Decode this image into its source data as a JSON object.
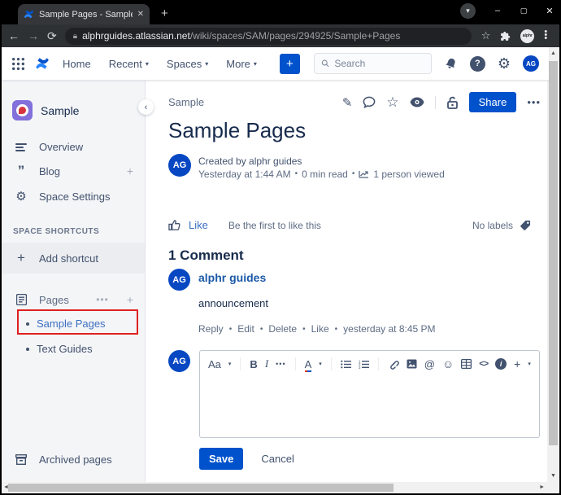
{
  "browser": {
    "tab_title": "Sample Pages - Sample - Conflu",
    "tab_close": "✕",
    "new_tab": "+",
    "back": "←",
    "forward": "→",
    "reload": "⟳",
    "url_domain": "alphrguides.atlassian.net",
    "url_path": "/wiki/spaces/SAM/pages/294925/Sample+Pages",
    "profile_label": "alphr",
    "minimize": "–",
    "maximize": "▢",
    "close": "✕",
    "flag_chevron": "▾"
  },
  "nav": {
    "home": "Home",
    "recent": "Recent",
    "spaces": "Spaces",
    "more": "More",
    "create": "+",
    "search_placeholder": "Search",
    "avatar_initials": "AG"
  },
  "sidebar": {
    "space_name": "Sample",
    "collapse": "‹",
    "overview": "Overview",
    "blog": "Blog",
    "space_settings": "Space Settings",
    "shortcuts_header": "SPACE SHORTCUTS",
    "add_shortcut": "Add shortcut",
    "pages_header": "Pages",
    "page_selected": "Sample Pages",
    "page_other": "Text Guides",
    "archived": "Archived pages",
    "annotation_color": "#E02020"
  },
  "content": {
    "breadcrumb": "Sample",
    "share": "Share",
    "title": "Sample Pages",
    "byline": {
      "initials": "AG",
      "created_by": "Created by alphr guides",
      "timestamp": "Yesterday at 1:44 AM",
      "read_time": "0 min read",
      "views": "1 person viewed"
    },
    "like": {
      "like_label": "Like",
      "prompt": "Be the first to like this",
      "no_labels": "No labels"
    },
    "comments": {
      "heading": "1 Comment",
      "initials": "AG",
      "author": "alphr guides",
      "body": "announcement",
      "action_reply": "Reply",
      "action_edit": "Edit",
      "action_delete": "Delete",
      "action_like": "Like",
      "timestamp": "yesterday at 8:45 PM"
    }
  },
  "editor": {
    "initials": "AG",
    "style": "Aa",
    "bold": "B",
    "italic": "I",
    "more": "•••",
    "color": "A",
    "mention": "@",
    "emoji": "☺",
    "code": "<>",
    "info": "i",
    "plus": "+",
    "save": "Save",
    "cancel": "Cancel"
  },
  "colors": {
    "accent": "#0052CC",
    "annotation": "#E02020"
  }
}
